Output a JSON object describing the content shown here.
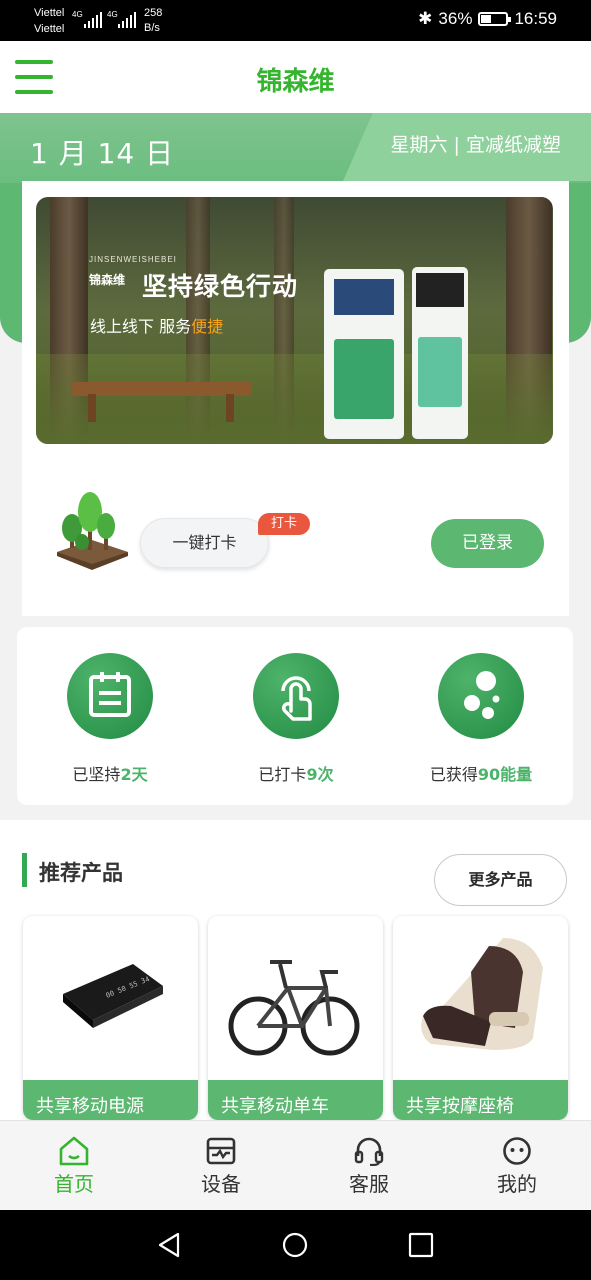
{
  "status_bar": {
    "carrier1": "Viettel",
    "carrier2": "Viettel",
    "net1": "4G",
    "net2": "4G",
    "speed_value": "258",
    "speed_unit": "B/s",
    "battery": "36%",
    "time": "16:59"
  },
  "header": {
    "title": "锦森维"
  },
  "date_band": {
    "date": "1 月 14 日",
    "weekday": "星期六 | 宜减纸减塑"
  },
  "banner": {
    "small": "JINSENWEISHEBEI",
    "brand": "锦森维",
    "title": "坚持绿色行动",
    "sub_prefix": "线上线下 服务",
    "sub_highlight": "便捷"
  },
  "checkin": {
    "button": "一键打卡",
    "badge": "打卡",
    "login": "已登录"
  },
  "stats": [
    {
      "prefix": "已坚持",
      "value": "2天",
      "suffix": ""
    },
    {
      "prefix": "已打卡",
      "value": "9次",
      "suffix": ""
    },
    {
      "prefix": "已获得",
      "value": "90",
      "suffix": "能量"
    }
  ],
  "recommend": {
    "title": "推荐产品",
    "more": "更多产品",
    "products": [
      {
        "name": "共享移动电源",
        "screen": "00 50 55 34"
      },
      {
        "name": "共享移动单车"
      },
      {
        "name": "共享按摩座椅"
      }
    ]
  },
  "tabs": [
    {
      "label": "首页",
      "icon": "home-icon",
      "active": true
    },
    {
      "label": "设备",
      "icon": "device-icon",
      "active": false
    },
    {
      "label": "客服",
      "icon": "headset-icon",
      "active": false
    },
    {
      "label": "我的",
      "icon": "profile-icon",
      "active": false
    }
  ],
  "colors": {
    "brand_green": "#35b52f",
    "accent_green": "#5cb871",
    "badge_red": "#e9573f"
  }
}
